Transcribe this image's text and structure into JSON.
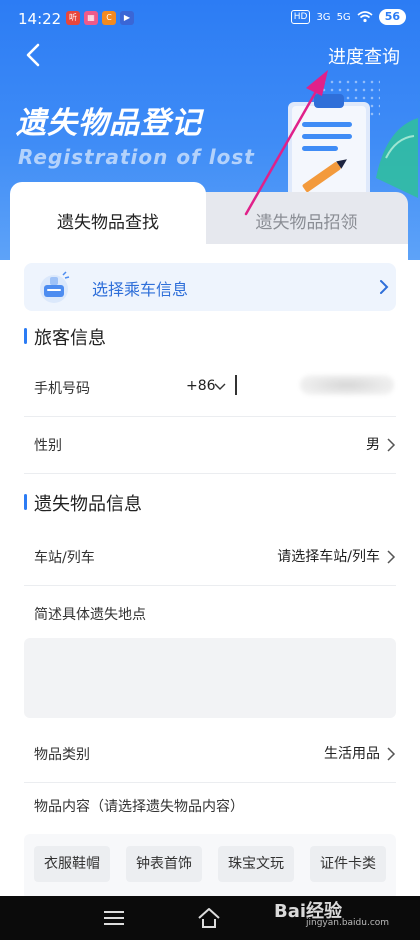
{
  "status_bar": {
    "time": "14:22",
    "network_1": "HD",
    "network_2": "3G",
    "network_3": "5G",
    "battery": "56"
  },
  "header": {
    "back_icon": "chevron-left-icon",
    "progress_query": "进度查询",
    "title": "遗失物品登记",
    "subtitle": "Registration of lost"
  },
  "tabs": [
    {
      "label": "遗失物品查找",
      "active": true
    },
    {
      "label": "遗失物品招领",
      "active": false
    }
  ],
  "ride_info": {
    "label": "选择乘车信息"
  },
  "passenger_section": {
    "title": "旅客信息",
    "phone_label": "手机号码",
    "country_code": "+86",
    "gender_label": "性别",
    "gender_value": "男"
  },
  "lost_item_section": {
    "title": "遗失物品信息",
    "station_label": "车站/列车",
    "station_placeholder": "请选择车站/列车",
    "location_label": "简述具体遗失地点",
    "location_value": "",
    "category_label": "物品类别",
    "category_value": "生活用品",
    "content_label": "物品内容（请选择遗失物品内容）",
    "content_tags": [
      "衣服鞋帽",
      "钟表首饰",
      "珠宝文玩",
      "证件卡类"
    ]
  },
  "watermark": {
    "brand": "Bai经验",
    "url": "jingyan.baidu.com"
  },
  "colors": {
    "primary": "#2c7cf4",
    "link_blue": "#2f6fd9",
    "annotation_arrow": "#e0218a"
  }
}
